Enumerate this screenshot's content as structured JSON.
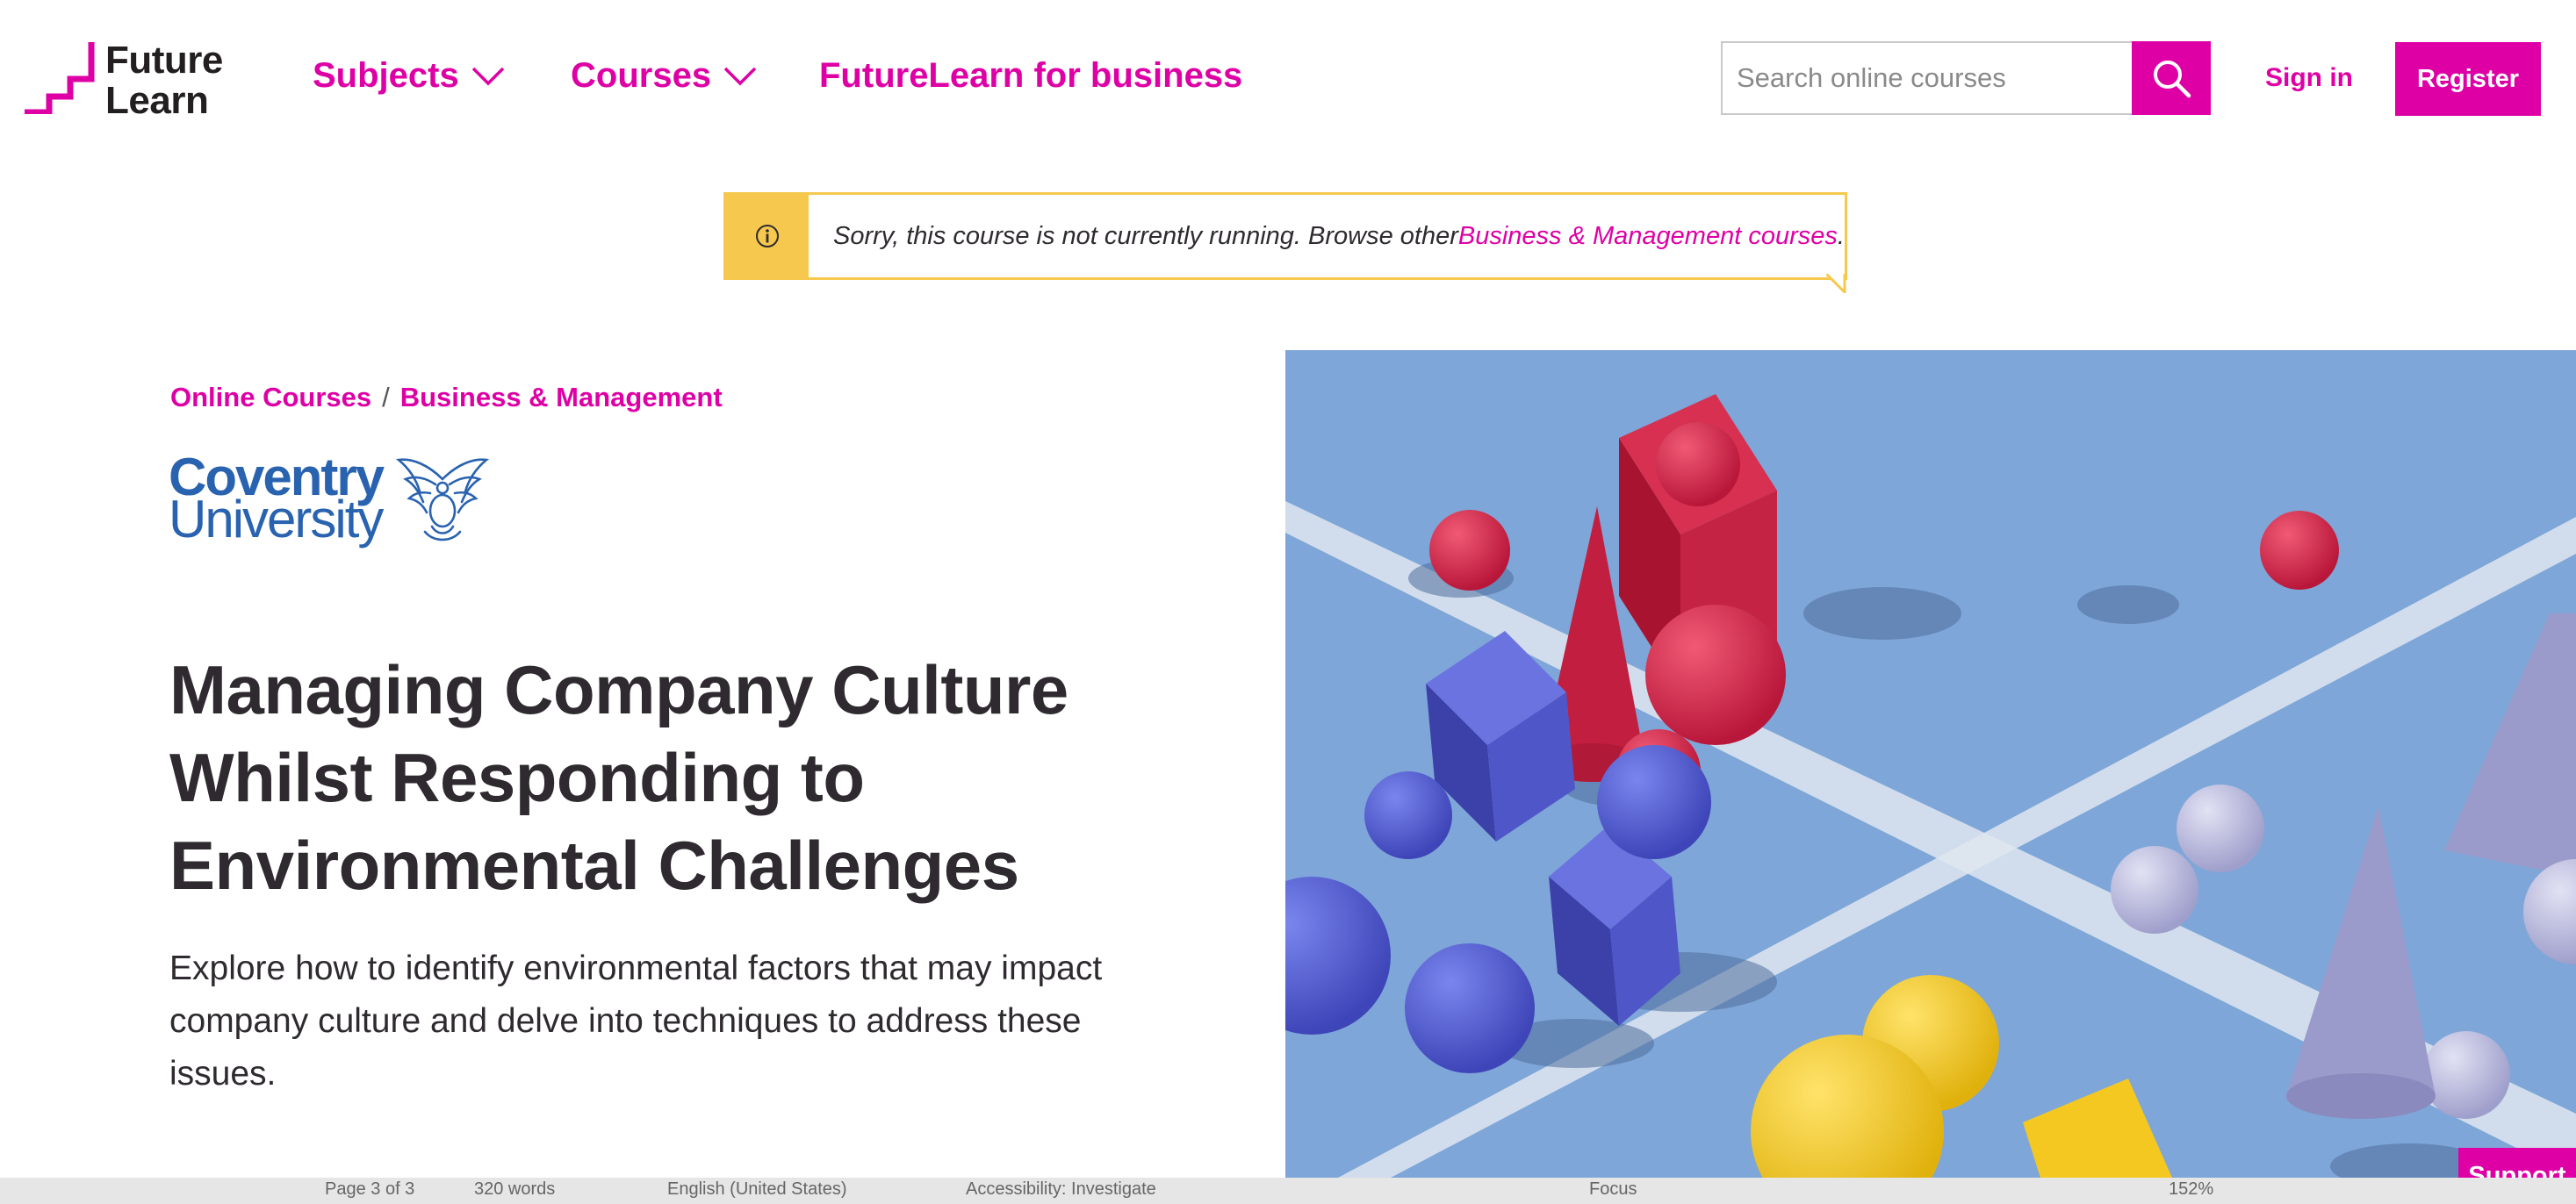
{
  "header": {
    "logo_line1": "Future",
    "logo_line2": "Learn",
    "nav": [
      {
        "label": "Subjects"
      },
      {
        "label": "Courses"
      },
      {
        "label": "FutureLearn for business"
      }
    ],
    "search_placeholder": "Search online courses",
    "signin_label": "Sign in",
    "register_label": "Register"
  },
  "notice": {
    "text": "Sorry, this course is not currently running. Browse other ",
    "link": "Business & Management courses",
    "suffix": "."
  },
  "breadcrumb": {
    "items": [
      "Online Courses",
      "Business & Management"
    ],
    "separator": "/"
  },
  "provider": {
    "line1": "Coventry",
    "line2": "University"
  },
  "course": {
    "title": "Managing Company Culture Whilst Responding to Environmental Challenges",
    "description": "Explore how to identify environmental factors that may impact company culture and delve into techniques to address these issues."
  },
  "support_label": "Support",
  "statusbar": [
    "Page 3 of 3",
    "320 words",
    "English (United States)",
    "Accessibility: Investigate",
    "Focus",
    "152%"
  ],
  "colors": {
    "brand": "#de00a5",
    "notice": "#f6c94e",
    "text": "#2e2a2f",
    "university": "#2963b0",
    "hero_bg": "#7ea6d8"
  }
}
